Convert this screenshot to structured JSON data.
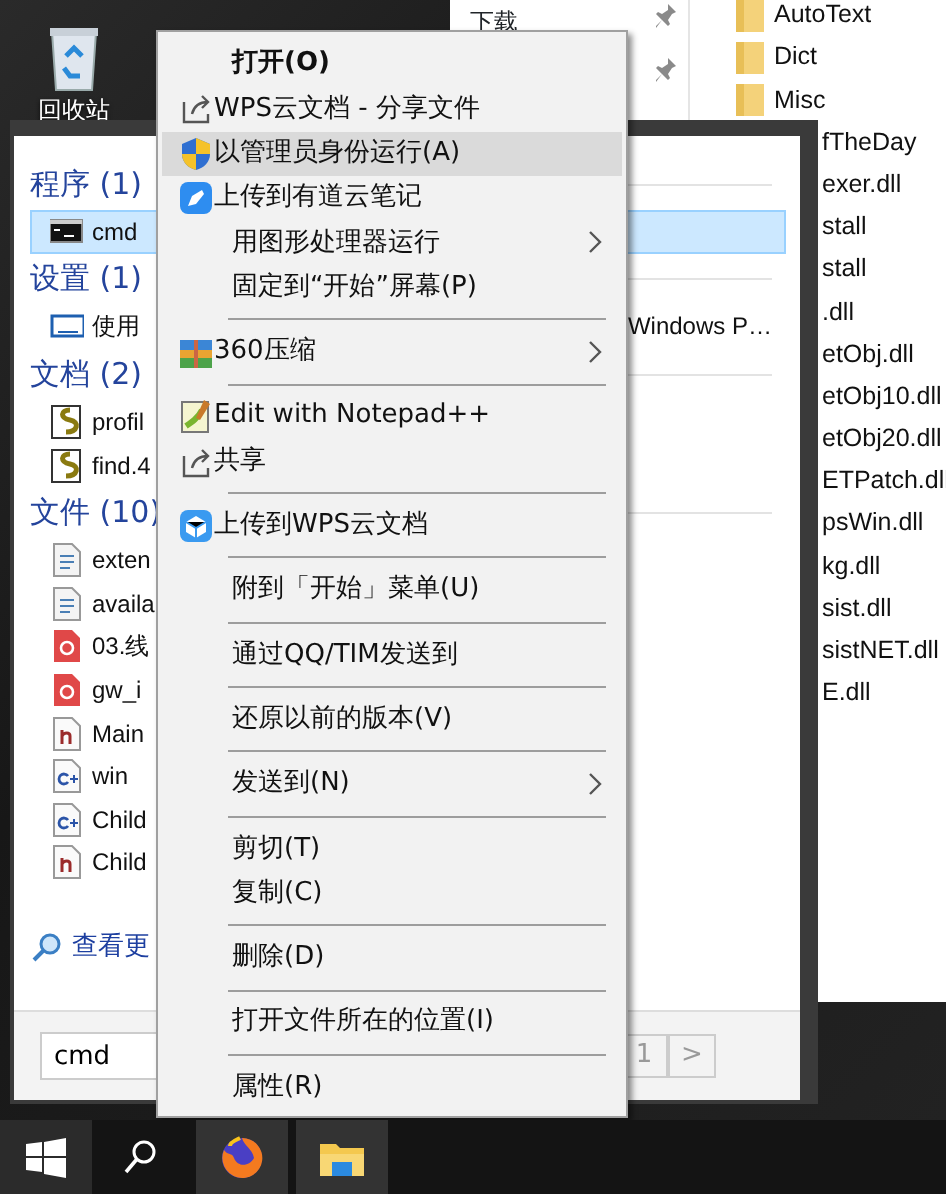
{
  "desktop": {
    "icons": [
      {
        "label": "回收站"
      }
    ]
  },
  "explorer": {
    "nav_items": [
      {
        "label": "下载"
      }
    ],
    "files": [
      {
        "name": "AutoText",
        "kind": "folder"
      },
      {
        "name": "Dict",
        "kind": "folder"
      },
      {
        "name": "Misc",
        "kind": "folder"
      },
      {
        "name": "fTheDay",
        "kind": "file"
      },
      {
        "name": "exer.dll",
        "kind": "file"
      },
      {
        "name": "stall",
        "kind": "file"
      },
      {
        "name": "stall",
        "kind": "file"
      },
      {
        "name": ".dll",
        "kind": "file"
      },
      {
        "name": "etObj.dll",
        "kind": "file"
      },
      {
        "name": "etObj10.dll",
        "kind": "file"
      },
      {
        "name": "etObj20.dll",
        "kind": "file"
      },
      {
        "name": "ETPatch.dll",
        "kind": "file"
      },
      {
        "name": "psWin.dll",
        "kind": "file"
      },
      {
        "name": "kg.dll",
        "kind": "file"
      },
      {
        "name": "sist.dll",
        "kind": "file"
      },
      {
        "name": "sistNET.dll",
        "kind": "file"
      },
      {
        "name": "E.dll",
        "kind": "file"
      }
    ]
  },
  "search": {
    "groups": [
      {
        "heading": "程序 (1)",
        "items": [
          {
            "name": "cmd",
            "kind": "console",
            "selected": true
          }
        ]
      },
      {
        "heading": "设置 (1)",
        "items": [
          {
            "name": "使用",
            "detail": "Windows P…",
            "kind": "monitor",
            "selected": false
          }
        ]
      },
      {
        "heading": "文档 (2)",
        "items": [
          {
            "name": "profil",
            "kind": "script",
            "selected": false
          },
          {
            "name": "find.4",
            "kind": "script",
            "selected": false
          }
        ]
      },
      {
        "heading": "文件 (10)",
        "items": [
          {
            "name": "exten",
            "kind": "config",
            "selected": false
          },
          {
            "name": "availa",
            "kind": "config",
            "selected": false
          },
          {
            "name": "03.线",
            "kind": "pdf",
            "selected": false
          },
          {
            "name": "gw_i",
            "kind": "pdf",
            "selected": false
          },
          {
            "name": "Main",
            "kind": "header",
            "selected": false
          },
          {
            "name": "win",
            "kind": "cpp",
            "selected": false
          },
          {
            "name": "Child",
            "kind": "cpp",
            "selected": false
          },
          {
            "name": "Child",
            "kind": "header",
            "selected": false
          }
        ]
      }
    ],
    "more_link": "查看更",
    "query": "cmd",
    "pager": [
      "1",
      ">"
    ]
  },
  "context_menu": [
    {
      "kind": "plain",
      "label": "打开(O)",
      "default": true,
      "selected": false,
      "submenu": false
    },
    {
      "kind": "share",
      "label": "WPS云文档 - 分享文件",
      "default": false,
      "selected": false,
      "submenu": false
    },
    {
      "kind": "shield",
      "label": "以管理员身份运行(A)",
      "default": false,
      "selected": true,
      "submenu": false
    },
    {
      "kind": "note",
      "label": "上传到有道云笔记",
      "default": false,
      "selected": false,
      "submenu": false
    },
    {
      "kind": "plain",
      "label": "用图形处理器运行",
      "default": false,
      "selected": false,
      "submenu": true
    },
    {
      "kind": "plain",
      "label": "固定到“开始”屏幕(P)",
      "default": false,
      "selected": false,
      "submenu": false
    },
    {
      "kind": "separator"
    },
    {
      "kind": "archive",
      "label": "360压缩",
      "default": false,
      "selected": false,
      "submenu": true
    },
    {
      "kind": "separator"
    },
    {
      "kind": "notepad",
      "label": "Edit with Notepad++",
      "default": false,
      "selected": false,
      "submenu": false
    },
    {
      "kind": "share",
      "label": "共享",
      "default": false,
      "selected": false,
      "submenu": false
    },
    {
      "kind": "separator"
    },
    {
      "kind": "cube",
      "label": "上传到WPS云文档",
      "default": false,
      "selected": false,
      "submenu": false
    },
    {
      "kind": "separator"
    },
    {
      "kind": "plain",
      "label": "附到「开始」菜单(U)",
      "default": false,
      "selected": false,
      "submenu": false
    },
    {
      "kind": "separator"
    },
    {
      "kind": "plain",
      "label": "通过QQ/TIM发送到",
      "default": false,
      "selected": false,
      "submenu": false
    },
    {
      "kind": "separator"
    },
    {
      "kind": "plain",
      "label": "还原以前的版本(V)",
      "default": false,
      "selected": false,
      "submenu": false
    },
    {
      "kind": "separator"
    },
    {
      "kind": "plain",
      "label": "发送到(N)",
      "default": false,
      "selected": false,
      "submenu": true
    },
    {
      "kind": "separator"
    },
    {
      "kind": "plain",
      "label": "剪切(T)",
      "default": false,
      "selected": false,
      "submenu": false
    },
    {
      "kind": "plain",
      "label": "复制(C)",
      "default": false,
      "selected": false,
      "submenu": false
    },
    {
      "kind": "separator"
    },
    {
      "kind": "plain",
      "label": "删除(D)",
      "default": false,
      "selected": false,
      "submenu": false
    },
    {
      "kind": "separator"
    },
    {
      "kind": "plain",
      "label": "打开文件所在的位置(I)",
      "default": false,
      "selected": false,
      "submenu": false
    },
    {
      "kind": "separator"
    },
    {
      "kind": "plain",
      "label": "属性(R)",
      "default": false,
      "selected": false,
      "submenu": false
    }
  ]
}
